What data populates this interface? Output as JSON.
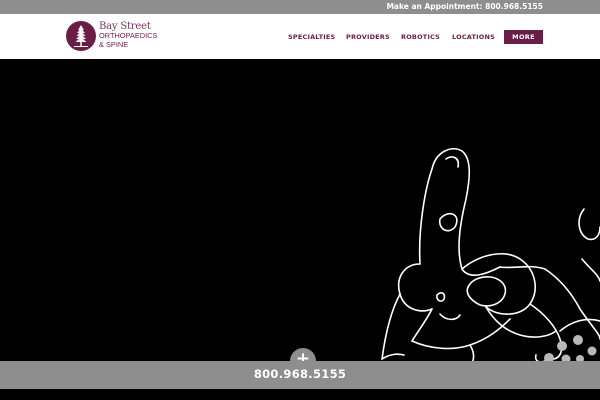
{
  "topbar": {
    "appointment_text": "Make an Appointment: 800.968.5155"
  },
  "logo": {
    "line1": "Bay Street",
    "line2": "ORTHOPAEDICS",
    "line3": "& SPINE",
    "brand_color": "#6b1e45"
  },
  "nav": {
    "items": [
      {
        "label": "SPECIALTIES"
      },
      {
        "label": "PROVIDERS"
      },
      {
        "label": "ROBOTICS"
      },
      {
        "label": "LOCATIONS"
      }
    ],
    "more_label": "MORE"
  },
  "callbar": {
    "phone": "800.968.5155",
    "plus_glyph": "+"
  },
  "colors": {
    "bar_gray": "#8e8e8e",
    "hero_bg": "#000000",
    "accent": "#6b1e45"
  },
  "icons": {
    "logo_emblem": "tree-icon",
    "expand": "plus-icon"
  }
}
